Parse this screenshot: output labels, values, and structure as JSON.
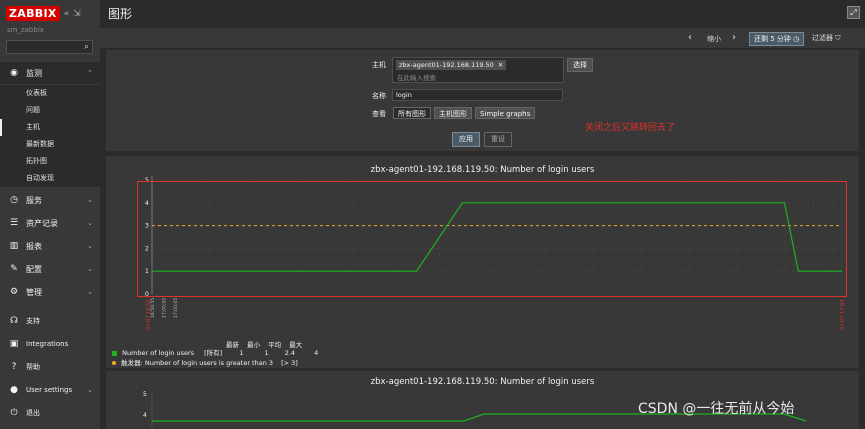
{
  "app": {
    "logo": "ZABBIX",
    "collapse_icon": "«",
    "kiosk_toggle_icon": "⇲",
    "server_name": "sm_zabbix"
  },
  "sidebar": {
    "monitoring": "监测",
    "sub_items": [
      "仪表板",
      "问题",
      "主机",
      "最新数据",
      "拓扑图",
      "自动发现"
    ],
    "services": "服务",
    "inventory": "资产记录",
    "reports": "报表",
    "configuration": "配置",
    "administration": "管理",
    "support": "支持",
    "integrations": "Integrations",
    "help": "帮助",
    "user_settings": "User settings",
    "logout": "退出"
  },
  "header": {
    "title": "图形"
  },
  "time_nav": {
    "zoom_out": "缩小",
    "range": "还剩 5 分钟",
    "filter": "过滤器"
  },
  "filter": {
    "host_label": "主机",
    "host_tag": "zbx-agent01-192.168.119.50",
    "host_placeholder": "在此输入搜索",
    "select_button": "选择",
    "name_label": "名称",
    "name_value": "login",
    "view_label": "查看",
    "view_options": [
      "所有图形",
      "主机图形",
      "Simple graphs"
    ],
    "apply_button": "应用",
    "reset_button": "重设"
  },
  "annotation": "关闭之后又跳转回去了",
  "graph1": {
    "title": "zbx-agent01-192.168.119.50: Number of login users",
    "legend": {
      "series_name": "Number of login users",
      "func": "[所有]",
      "headers": [
        "最新",
        "最小",
        "平均",
        "最大"
      ],
      "stats": [
        "1",
        "1",
        "2.4",
        "4"
      ],
      "trigger_text": "触发器: Number of login users is greater than 3",
      "trigger_cond": "[> 3]"
    }
  },
  "graph2": {
    "title": "zbx-agent01-192.168.119.50: Number of login users"
  },
  "chart_data": {
    "type": "line",
    "title": "zbx-agent01-192.168.119.50: Number of login users",
    "y_ticks": [
      "0",
      "1",
      "2",
      "3",
      "4",
      "5"
    ],
    "ylim": [
      0,
      5
    ],
    "x_start_label": "07-07 16:59",
    "x_end_label": "07-07 17:04",
    "x_tick_labels_visible": [
      "16:59:55",
      "17:00:00",
      "17:00:05"
    ],
    "series": [
      {
        "name": "Number of login users",
        "x": [
          "16:59:55",
          "17:01:50",
          "17:02:10",
          "17:04:30",
          "17:04:36",
          "17:04:55"
        ],
        "values": [
          1,
          1,
          4,
          4,
          1,
          1
        ]
      }
    ],
    "trigger_threshold": 3,
    "colors": {
      "series": "#1fb11f",
      "trigger": "#f5a623",
      "frame": "#e0312b"
    },
    "grid": true
  },
  "watermark": "CSDN @一往无前从今始"
}
